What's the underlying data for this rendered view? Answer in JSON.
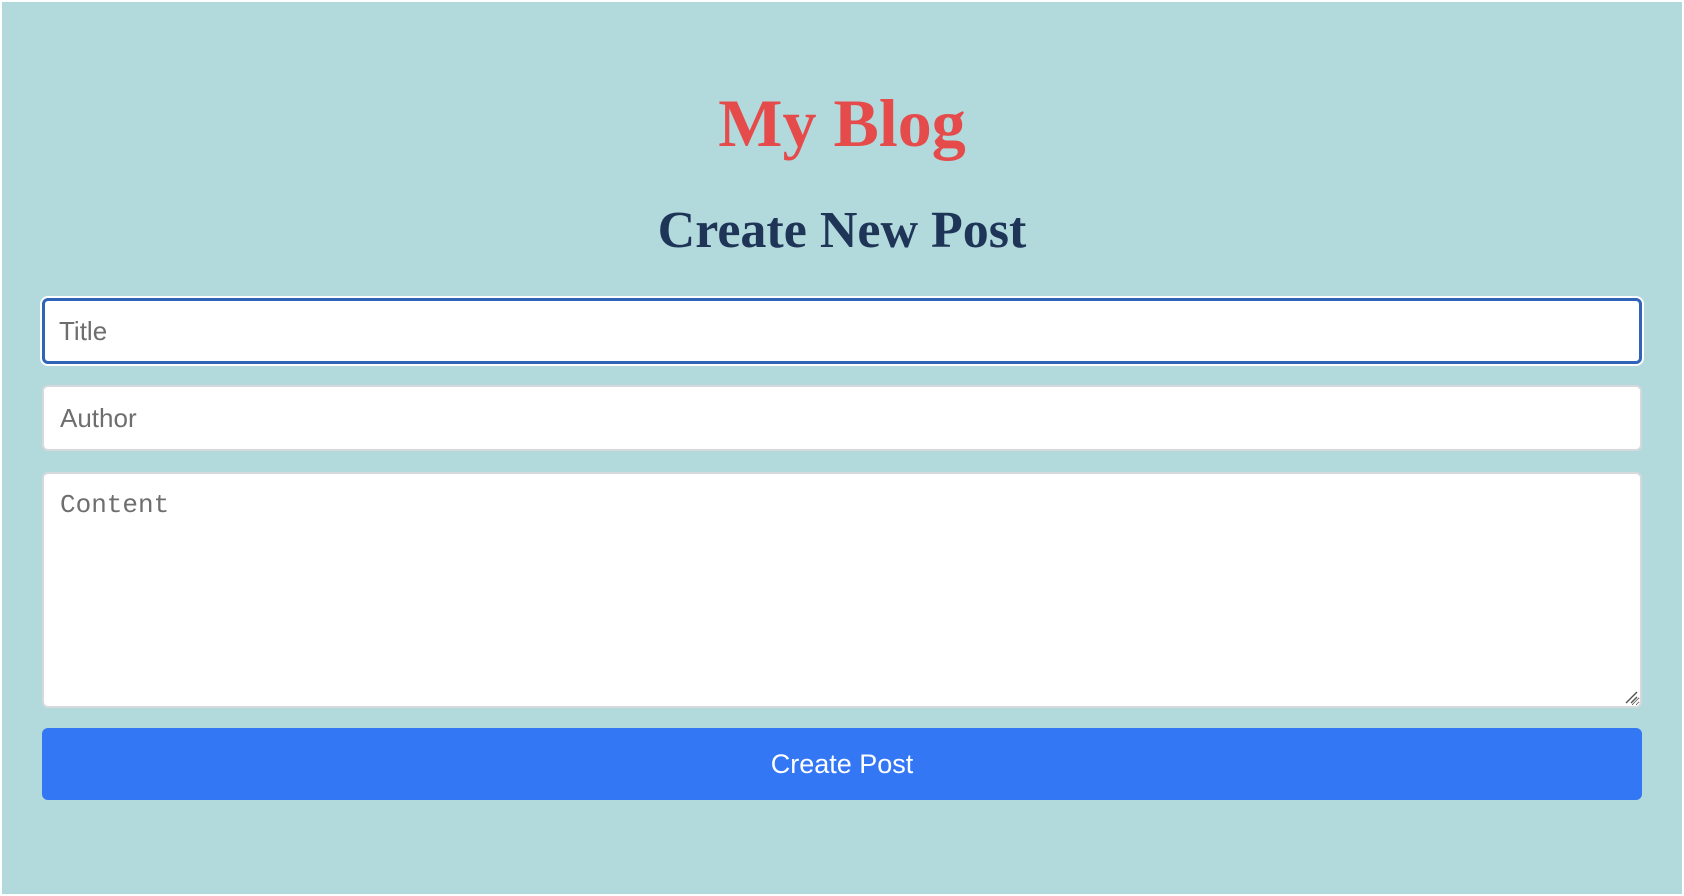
{
  "header": {
    "blog_title": "My Blog",
    "section_title": "Create New Post"
  },
  "form": {
    "title_placeholder": "Title",
    "title_value": "",
    "author_placeholder": "Author",
    "author_value": "",
    "content_placeholder": "Content",
    "content_value": "",
    "submit_label": "Create Post"
  },
  "colors": {
    "background": "#b2dadd",
    "blog_title": "#e64b4b",
    "section_title": "#1e3557",
    "focus_border": "#2f64b8",
    "button": "#3477f5",
    "button_text": "#ffffff"
  }
}
